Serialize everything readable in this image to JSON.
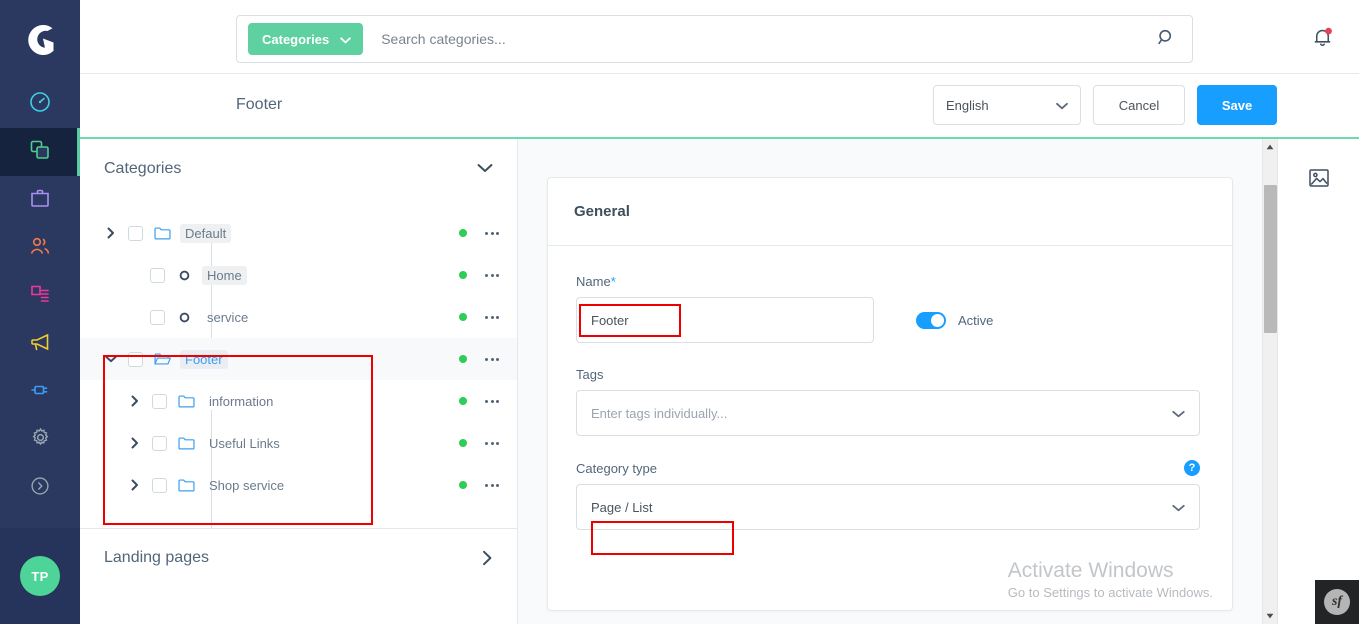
{
  "app": {
    "brand": "Shopware",
    "accent_green": "#5fd0a0",
    "accent_blue": "#189eff",
    "sidebar_bg": "#2b3961",
    "status_dot": "#2ecc58",
    "annotation_color": "#ee0000"
  },
  "sidebar": {
    "logo_name": "shopware-logo-icon",
    "items": [
      {
        "name": "dashboard",
        "icon": "speedometer-icon",
        "color": "#3ecfe0",
        "active": false
      },
      {
        "name": "catalogues",
        "icon": "stacked-squares-icon",
        "color": "#4ecf8e",
        "active": true
      },
      {
        "name": "orders",
        "icon": "briefcase-icon",
        "color": "#a98ff5",
        "active": false
      },
      {
        "name": "customers",
        "icon": "people-icon",
        "color": "#f57a49",
        "active": false
      },
      {
        "name": "content",
        "icon": "content-page-icon",
        "color": "#f2369a",
        "active": false
      },
      {
        "name": "marketing",
        "icon": "megaphone-icon",
        "color": "#f5cb2d",
        "active": false
      },
      {
        "name": "extensions",
        "icon": "plug-icon",
        "color": "#3a9cf5",
        "active": false
      },
      {
        "name": "settings",
        "icon": "gear-icon",
        "color": "#9aa5b1",
        "active": false
      },
      {
        "name": "help",
        "icon": "chevron-circle-icon",
        "color": "#9aa5b1",
        "active": false
      }
    ],
    "avatar_initials": "TP"
  },
  "topbar": {
    "scope_label": "Categories",
    "scope_chevron": "chevron-down-icon",
    "search_placeholder": "Search categories...",
    "search_value": "",
    "search_icon": "search-icon",
    "notification_icon": "bell-icon",
    "notification_has_badge": true
  },
  "smartbar": {
    "title": "Footer",
    "language": "English",
    "language_chevron": "chevron-down-icon",
    "cancel_label": "Cancel",
    "save_label": "Save"
  },
  "tree": {
    "header_title": "Categories",
    "header_toggle_icon": "chevron-down-icon",
    "rows": [
      {
        "label": "Default",
        "depth": 0,
        "arrow": "right",
        "icon": "folder-closed-icon",
        "highlight": "grey",
        "active_dot": true
      },
      {
        "label": "Home",
        "depth": 1,
        "arrow": "none",
        "icon": "circle-dot-icon",
        "highlight": "grey",
        "active_dot": true
      },
      {
        "label": "service",
        "depth": 1,
        "arrow": "none",
        "icon": "circle-dot-icon",
        "highlight": "none",
        "active_dot": true
      },
      {
        "label": "Footer",
        "depth": 0,
        "arrow": "down",
        "icon": "folder-open-icon",
        "highlight": "selected",
        "active_dot": true
      },
      {
        "label": "information",
        "depth": 1,
        "arrow": "right",
        "icon": "folder-closed-icon",
        "highlight": "none",
        "active_dot": true
      },
      {
        "label": "Useful Links",
        "depth": 1,
        "arrow": "right",
        "icon": "folder-closed-icon",
        "highlight": "none",
        "active_dot": true
      },
      {
        "label": "Shop service",
        "depth": 1,
        "arrow": "right",
        "icon": "folder-closed-icon",
        "highlight": "none",
        "active_dot": true
      }
    ],
    "row_menu_icon": "ellipsis-icon",
    "landing_pages_label": "Landing pages",
    "landing_pages_icon": "chevron-right-icon"
  },
  "detail": {
    "card_title": "General",
    "name_label": "Name",
    "name_required_mark": "*",
    "name_value": "Footer",
    "active_toggle_label": "Active",
    "active_toggle_on": true,
    "tags_label": "Tags",
    "tags_placeholder": "Enter tags individually...",
    "tags_value": "",
    "category_type_label": "Category type",
    "category_type_value": "Page / List",
    "category_type_help_icon": "question-mark-icon",
    "chevron_icon": "chevron-down-icon"
  },
  "utility_rail": {
    "items": [
      {
        "name": "media-image-icon"
      }
    ]
  },
  "scrollbar": {
    "up_icon": "caret-up-icon",
    "down_icon": "caret-down-icon"
  },
  "watermark": {
    "line1": "Activate Windows",
    "line2": "Go to Settings to activate Windows."
  },
  "symfony_badge": {
    "label": "sf"
  }
}
